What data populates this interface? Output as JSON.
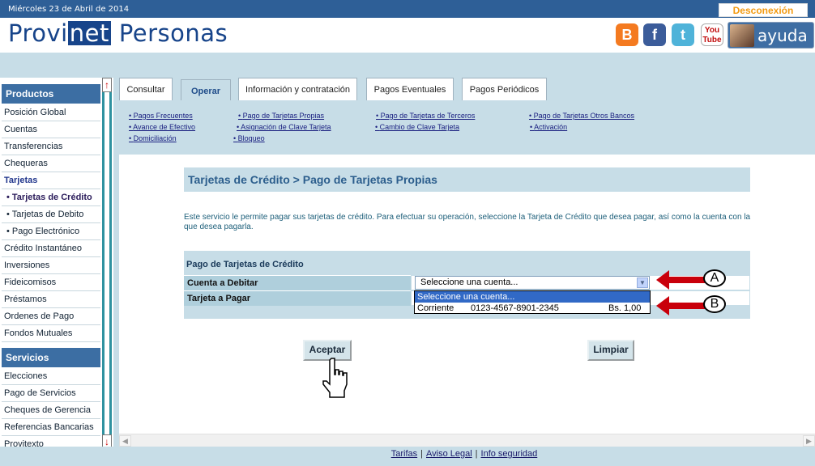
{
  "topbar": {
    "date": "Miércoles 23 de Abril de 2014",
    "disconnect": "Desconexión"
  },
  "brand": {
    "part1": "Provi",
    "part2": "net",
    "part3": "Personas"
  },
  "social": [
    {
      "icon": "blogger-icon",
      "glyph": "B"
    },
    {
      "icon": "facebook-icon",
      "glyph": "f"
    },
    {
      "icon": "twitter-icon",
      "glyph": "t"
    },
    {
      "icon": "youtube-icon",
      "glyph": "You Tube"
    }
  ],
  "help": {
    "label": "ayuda"
  },
  "sidebar": {
    "products_title": "Productos",
    "products": [
      "Posición Global",
      "Cuentas",
      "Transferencias",
      "Chequeras",
      "Tarjetas"
    ],
    "tarjetas_sub": [
      "• Tarjetas de Crédito",
      "• Tarjetas de Debito",
      "• Pago Electrónico"
    ],
    "products2": [
      "Crédito Instantáneo",
      "Inversiones",
      "Fideicomisos",
      "Préstamos",
      "Ordenes de Pago",
      "Fondos Mutuales"
    ],
    "services_title": "Servicios",
    "services": [
      "Elecciones",
      "Pago de Servicios",
      "Cheques de Gerencia",
      "Referencias Bancarias",
      "Provitexto"
    ]
  },
  "tabs": [
    "Consultar",
    "Operar",
    "Información y contratación",
    "Pagos Eventuales",
    "Pagos Periódicos"
  ],
  "subnav": {
    "col1": [
      "Pagos Frecuentes",
      "Avance de Efectivo",
      "Domiciliación"
    ],
    "col2": [
      "Pago de Tarjetas Propias",
      "Asignación de Clave Tarjeta",
      "Bloqueo"
    ],
    "col3": [
      "Pago de Tarjetas de Terceros",
      "Cambio de Clave Tarjeta"
    ],
    "col4": [
      "Pago de Tarjetas Otros Bancos",
      "Activación"
    ]
  },
  "page": {
    "title": "Tarjetas de Crédito > Pago de Tarjetas Propias",
    "intro": "Este servicio le permite pagar sus tarjetas de crédito. Para efectuar su operación, seleccione la Tarjeta de Crédito que desea pagar, así como la cuenta con la que desea pagarla."
  },
  "form": {
    "title": "Pago de Tarjetas de Crédito",
    "debit_label": "Cuenta a Debitar",
    "card_label": "Tarjeta a Pagar",
    "select_value": "Seleccione una cuenta...",
    "options": [
      {
        "text": "Seleccione una cuenta..."
      },
      {
        "type": "Corriente",
        "number": "0123-4567-8901-2345",
        "balance": "Bs. 1,00"
      }
    ]
  },
  "callouts": {
    "a": "A",
    "b": "B"
  },
  "buttons": {
    "accept": "Aceptar",
    "clear": "Limpiar"
  },
  "footer": {
    "links": [
      "Tarifas",
      "Aviso Legal",
      "Info seguridad"
    ]
  },
  "colors": {
    "brand": "#17448a",
    "accent": "#f39a11",
    "panel": "#c7dde7",
    "callout": "#c9000b"
  }
}
